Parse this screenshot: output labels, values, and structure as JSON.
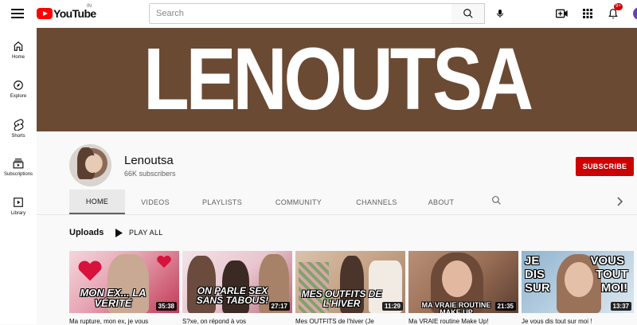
{
  "header": {
    "logo_text": "YouTube",
    "region": "IN",
    "search_placeholder": "Search",
    "notification_count": "9+"
  },
  "sidebar": {
    "items": [
      {
        "label": "Home",
        "icon": "home-icon"
      },
      {
        "label": "Explore",
        "icon": "compass-icon"
      },
      {
        "label": "Shorts",
        "icon": "shorts-icon"
      },
      {
        "label": "Subscriptions",
        "icon": "subscriptions-icon"
      },
      {
        "label": "Library",
        "icon": "library-icon"
      }
    ]
  },
  "banner": {
    "text": "LENOUTSA",
    "background": "#6b4a33"
  },
  "channel": {
    "name": "Lenoutsa",
    "subscribers": "66K subscribers",
    "subscribe_label": "SUBSCRIBE"
  },
  "tabs": [
    {
      "label": "HOME",
      "active": true
    },
    {
      "label": "VIDEOS",
      "active": false
    },
    {
      "label": "PLAYLISTS",
      "active": false
    },
    {
      "label": "COMMUNITY",
      "active": false
    },
    {
      "label": "CHANNELS",
      "active": false
    },
    {
      "label": "ABOUT",
      "active": false
    }
  ],
  "uploads": {
    "title": "Uploads",
    "play_all_label": "PLAY ALL",
    "videos": [
      {
        "overlay": "MON EX... LA VÉRITÉ",
        "duration": "35:38",
        "title": "Ma rupture, mon ex, je vous"
      },
      {
        "overlay": "ON PARLE SEX SANS TABOUS!",
        "duration": "27:17",
        "title": "S?xe, on répond à vos"
      },
      {
        "overlay": "MES OUTFITS DE L'HIVER",
        "duration": "11:29",
        "title": "Mes OUTFITS de l'hiver (Je"
      },
      {
        "overlay": "MA VRAIE ROUTINE MAKE UP",
        "duration": "21:35",
        "title": "Ma VRAIE routine Make Up!"
      },
      {
        "overlay": "JE VOUS DIS TOUT SUR MOI!",
        "duration": "13:37",
        "title": "Je vous dis tout sur moi !"
      }
    ]
  },
  "colors": {
    "brand_red": "#ff0000",
    "subscribe_red": "#cc0000"
  }
}
